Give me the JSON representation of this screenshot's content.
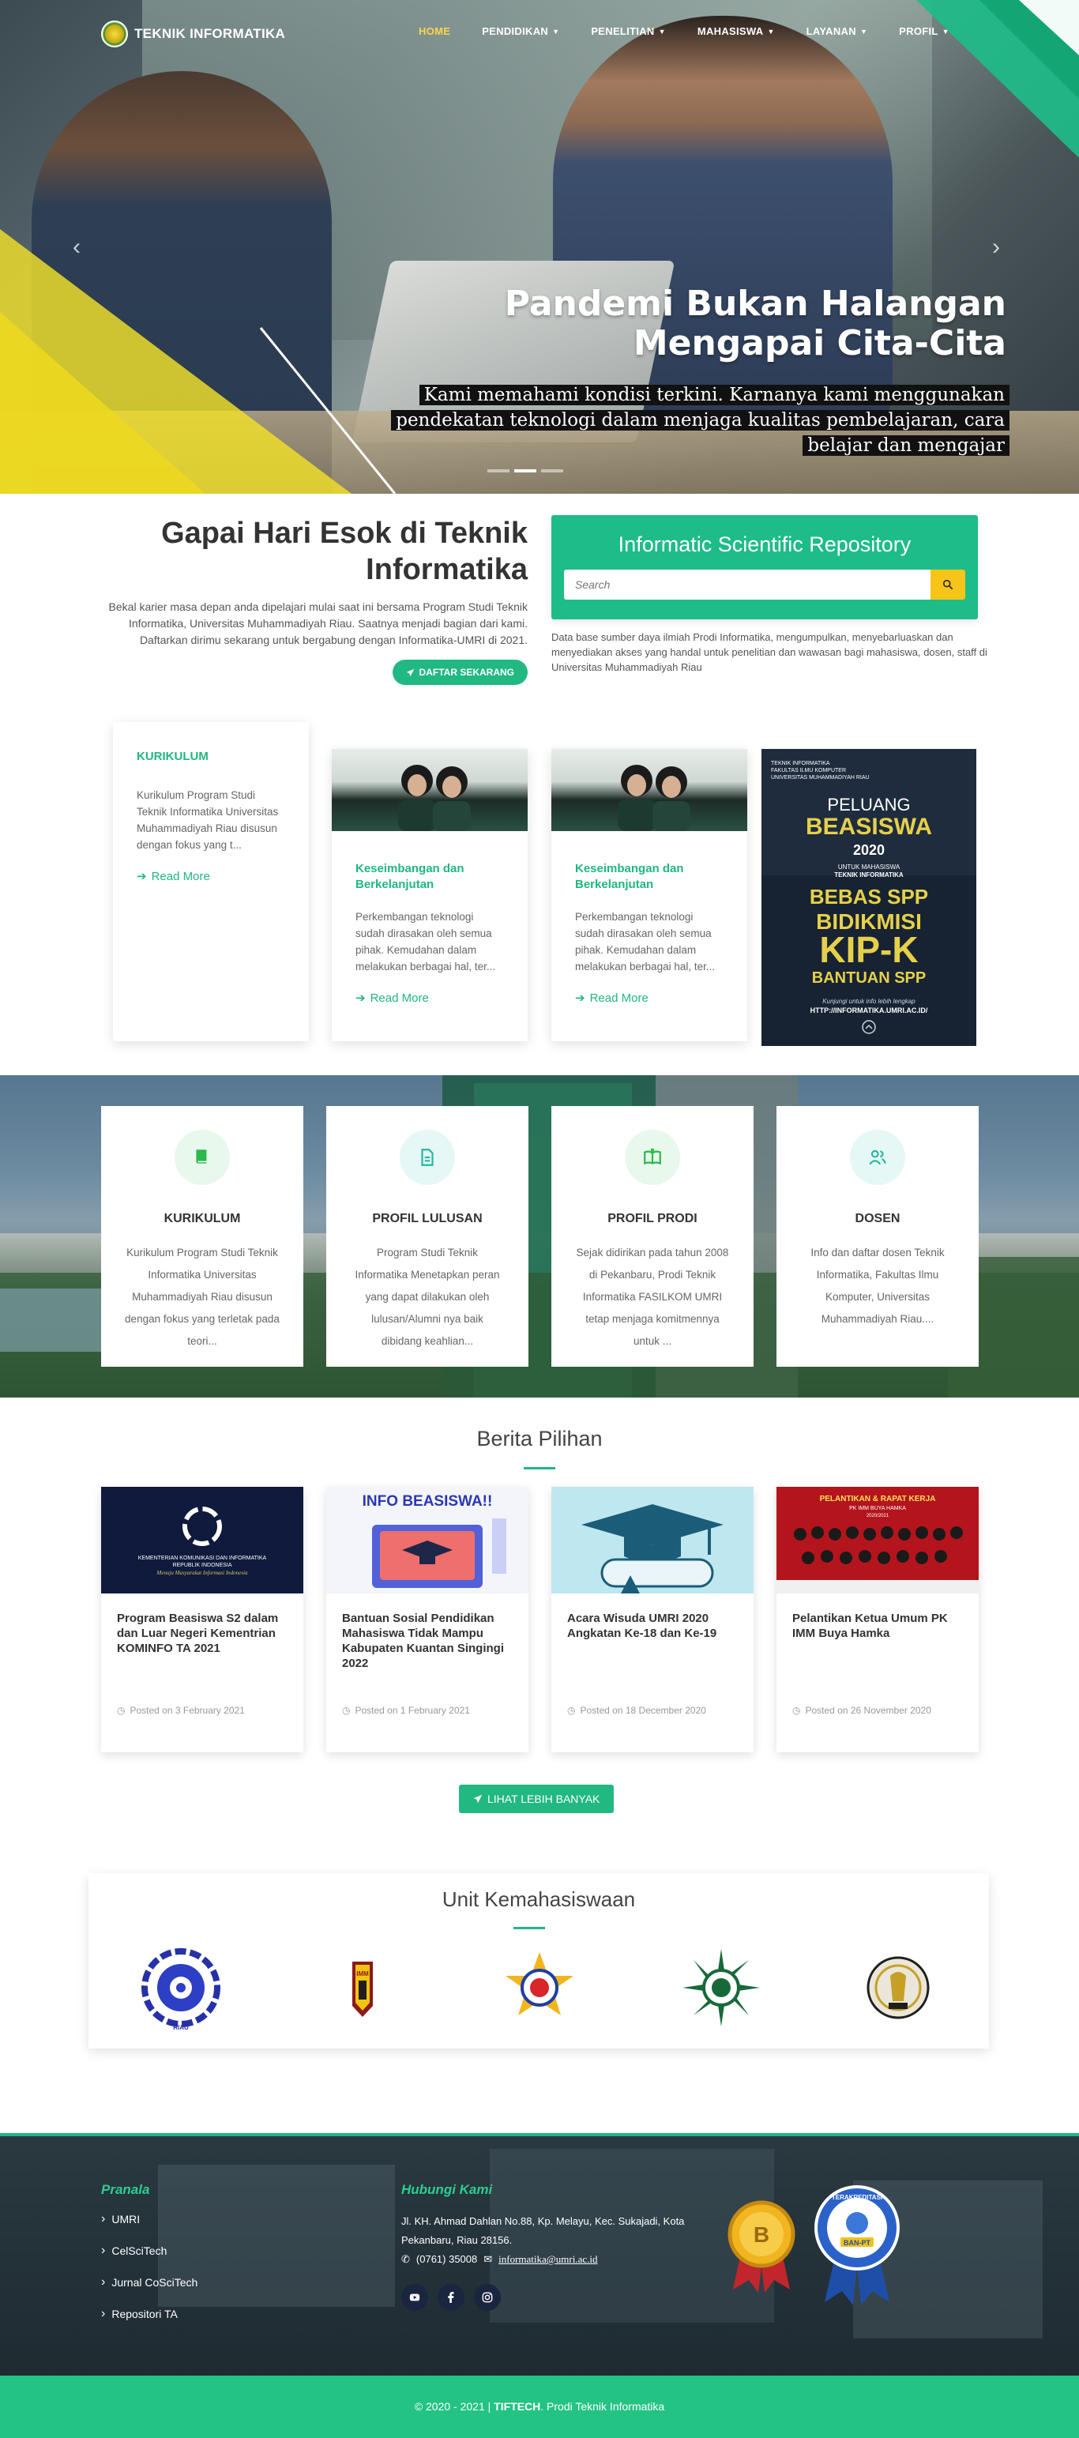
{
  "nav": {
    "brand": "TEKNIK INFORMATIKA",
    "items": [
      {
        "label": "HOME",
        "caret": false
      },
      {
        "label": "PENDIDIKAN",
        "caret": true
      },
      {
        "label": "PENELITIAN",
        "caret": true
      },
      {
        "label": "MAHASISWA",
        "caret": true
      },
      {
        "label": "LAYANAN",
        "caret": true
      },
      {
        "label": "PROFIL",
        "caret": true
      }
    ]
  },
  "hero": {
    "title_line1": "Pandemi Bukan Halangan",
    "title_line2": "Mengapai Cita-Cita",
    "subtitle": "Kami memahami kondisi terkini. Karnanya kami menggunakan pendekatan teknologi dalam menjaga kualitas pembelajaran, cara belajar dan mengajar",
    "prev": "‹",
    "next": "›"
  },
  "intro": {
    "heading": "Gapai Hari Esok di Teknik Informatika",
    "text": "Bekal karier masa depan anda dipelajari mulai saat ini bersama Program Studi Teknik Informatika, Universitas Muhammadiyah Riau. Saatnya menjadi bagian dari kami. Daftarkan dirimu sekarang untuk bergabung dengan Informatika-UMRI di 2021.",
    "button": "DAFTAR SEKARANG"
  },
  "repo": {
    "title": "Informatic Scientific Repository",
    "search_placeholder": "Search",
    "description": "Data base sumber daya ilmiah Prodi Informatika, mengumpulkan, menyebarluaskan dan menyediakan akses yang handal untuk penelitian dan wawasan bagi mahasiswa, dosen, staff di Universitas Muhammadiyah Riau"
  },
  "cards": [
    {
      "title": "KURIKULUM",
      "text": "Kurikulum Program Studi Teknik Informatika Universitas Muhammadiyah Riau disusun dengan fokus yang t...",
      "link": "Read More"
    },
    {
      "title": "Keseimbangan dan Berkelanjutan",
      "text": "Perkembangan teknologi sudah dirasakan oleh semua pihak. Kemudahan dalam melakukan berbagai hal, ter...",
      "link": "Read More"
    },
    {
      "title": "Keseimbangan dan Berkelanjutan",
      "text": "Perkembangan teknologi sudah dirasakan oleh semua pihak. Kemudahan dalam melakukan berbagai hal, ter...",
      "link": "Read More"
    }
  ],
  "poster": {
    "head1": "TEKNIK INFORMATIKA",
    "head2": "FAKULTAS ILMU KOMPUTER",
    "head3": "UNIVERSITAS MUHAMMADIYAH RIAU",
    "peluang": "PELUANG",
    "beasiswa": "BEASISWA",
    "year": "2020",
    "untuk1": "UNTUK MAHASISWA",
    "untuk2": "TEKNIK INFORMATIKA",
    "bebas": "BEBAS SPP",
    "bidikmisi": "BIDIKMISI",
    "kipk": "KIP-K",
    "bantuan": "BANTUAN SPP",
    "info": "Kunjungi untuk info lebih lengkap",
    "url": "HTTP://INFORMATIKA.UMRI.AC.ID/"
  },
  "features": [
    {
      "title": "KURIKULUM",
      "text": "Kurikulum Program Studi Teknik Informatika Universitas Muhammadiyah Riau disusun dengan fokus yang terletak pada teori...",
      "icon": "book-icon",
      "bg": "#e8f8ec",
      "color": "#2bb84c"
    },
    {
      "title": "PROFIL LULUSAN",
      "text": "Program Studi Teknik Informatika Menetapkan peran yang dapat dilakukan oleh lulusan/Alumni nya baik dibidang keahlian...",
      "icon": "document-icon",
      "bg": "#e5f8f5",
      "color": "#26b6a3"
    },
    {
      "title": "PROFIL PRODI",
      "text": "Sejak didirikan pada tahun 2008 di Pekanbaru, Prodi Teknik Informatika FASILKOM UMRI tetap menjaga komitmennya untuk ...",
      "icon": "open-book-icon",
      "bg": "#e8f8ec",
      "color": "#2bb84c"
    },
    {
      "title": "DOSEN",
      "text": "Info dan daftar dosen Teknik Informatika, Fakultas Ilmu Komputer, Universitas Muhammadiyah Riau....",
      "icon": "users-icon",
      "bg": "#e5f8f5",
      "color": "#26b6a3"
    }
  ],
  "berita": {
    "title": "Berita Pilihan",
    "items": [
      {
        "title": "Program Beasiswa S2 dalam dan Luar Negeri Kementrian KOMINFO TA 2021",
        "date": "Posted on 3 February 2021",
        "img_line1": "KEMENTERIAN KOMUNIKASI DAN INFORMATIKA",
        "img_line2": "REPUBLIK INDONESIA",
        "img_line3": "Menuju Masyarakat Informasi Indonesia"
      },
      {
        "title": "Bantuan Sosial Pendidikan Mahasiswa Tidak Mampu Kabupaten Kuantan Singingi 2022",
        "date": "Posted on 1 February 2021",
        "img_line1": "INFO BEASISWA!!"
      },
      {
        "title": "Acara Wisuda UMRI 2020 Angkatan Ke-18 dan Ke-19",
        "date": "Posted on 18 December 2020"
      },
      {
        "title": "Pelantikan Ketua Umum PK IMM Buya Hamka",
        "date": "Posted on 26 November 2020",
        "img_line1": "PELANTIKAN & RAPAT KERJA",
        "img_line2": "PK IMM BUYA HAMKA",
        "img_line3": "2020/2021"
      }
    ],
    "more": "LIHAT LEBIH BANYAK"
  },
  "ukm": {
    "title": "Unit Kemahasiswaan",
    "logo_text": [
      "RIAU",
      "IMM"
    ]
  },
  "footer": {
    "pranala_title": "Pranala",
    "links": [
      "UMRI",
      "CelSciTech",
      "Jurnal CoSciTech",
      "Repositori TA"
    ],
    "contact_title": "Hubungi Kami",
    "address": "Jl. KH. Ahmad Dahlan No.88, Kp. Melayu, Kec. Sukajadi, Kota Pekanbaru, Riau 28156.",
    "phone": "(0761) 35008",
    "email": "informatika@umri.ac.id",
    "badge1": "B",
    "badge2_top": "TERAKREDITASI",
    "badge2_mid": "BAN-PT",
    "copyright_prefix": "© 2020 - 2021 | ",
    "copyright_brand": "TIFTECH",
    "copyright_suffix": ". Prodi Teknik Informatika"
  },
  "colors": {
    "accent": "#21b882",
    "yellow": "#f7c518",
    "dark": "#25333a"
  }
}
